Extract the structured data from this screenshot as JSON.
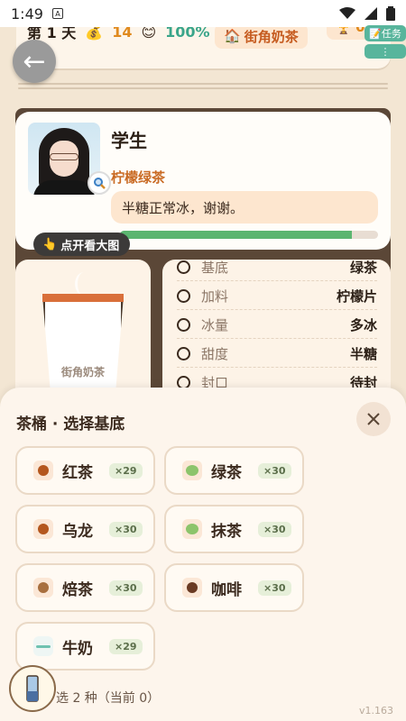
{
  "status_bar": {
    "time": "1:49"
  },
  "top_bar": {
    "day": "第 1 天",
    "money": "14",
    "percent": "100%",
    "shop_name": "街角奶茶",
    "trophy_count": "0",
    "task_label": "任务",
    "more_label": "⋮"
  },
  "customer": {
    "name": "学生",
    "drink": "柠檬绿茶",
    "speech": "半糖正常冰，谢谢。",
    "patience": 0.9,
    "view_big_label": "点开看大图"
  },
  "cup": {
    "label": "街角奶茶"
  },
  "recipe": [
    {
      "label": "基底",
      "value": "绿茶"
    },
    {
      "label": "加料",
      "value": "柠檬片"
    },
    {
      "label": "冰量",
      "value": "多冰"
    },
    {
      "label": "甜度",
      "value": "半糖"
    },
    {
      "label": "封口",
      "value": "待封"
    }
  ],
  "sheet": {
    "title": "茶桶 · 选择基底",
    "options": [
      {
        "name": "红茶",
        "count": "×29",
        "color": "#b4571e"
      },
      {
        "name": "绿茶",
        "count": "×30",
        "color": "#8cc46b"
      },
      {
        "name": "乌龙",
        "count": "×30",
        "color": "#b4571e"
      },
      {
        "name": "抹茶",
        "count": "×30",
        "color": "#8cc46b"
      },
      {
        "name": "焙茶",
        "count": "×30",
        "color": "#a86f3e"
      },
      {
        "name": "咖啡",
        "count": "×30",
        "color": "#6a3a22"
      },
      {
        "name": "牛奶",
        "count": "×29",
        "color": "#6fc2b0"
      }
    ],
    "hint": "选 2 种（当前 0）",
    "version": "v1.163"
  }
}
